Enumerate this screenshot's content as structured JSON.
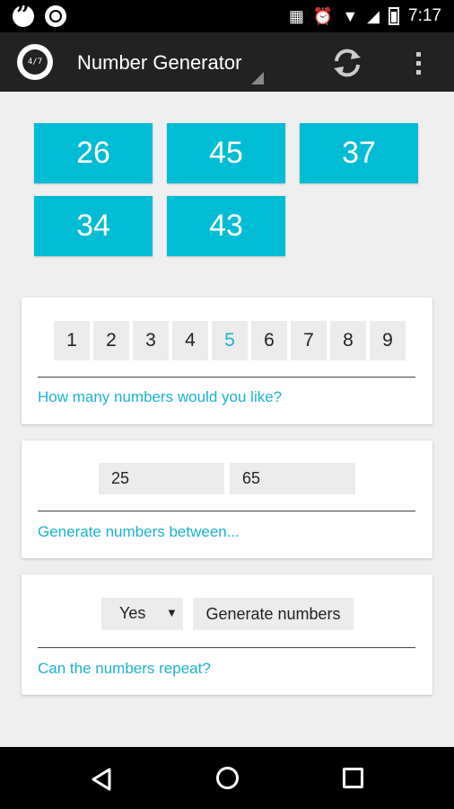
{
  "status_bar": {
    "time": "7:17",
    "icons": [
      "hangouts-icon",
      "app-notification-icon",
      "vibrate-icon",
      "alarm-icon",
      "wifi-icon",
      "signal-icon",
      "battery-icon"
    ]
  },
  "app_bar": {
    "title": "Number Generator",
    "logo_text": "4/7",
    "actions": [
      "refresh-icon",
      "overflow-menu-icon"
    ]
  },
  "results": [
    "26",
    "45",
    "37",
    "34",
    "43"
  ],
  "count_card": {
    "options": [
      "1",
      "2",
      "3",
      "4",
      "5",
      "6",
      "7",
      "8",
      "9"
    ],
    "selected": "5",
    "label": "How many numbers would you like?"
  },
  "range_card": {
    "min": "25",
    "max": "65",
    "label": "Generate numbers between..."
  },
  "repeat_card": {
    "repeat_value": "Yes",
    "generate_label": "Generate numbers",
    "label": "Can the numbers repeat?"
  },
  "colors": {
    "accent": "#00bcd4",
    "label_accent": "#1ab3cc",
    "app_bar": "#222222"
  }
}
